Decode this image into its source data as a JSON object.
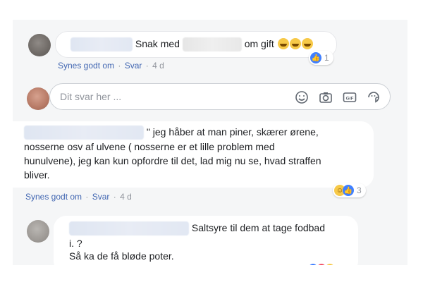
{
  "comments": [
    {
      "text_before": "Snak med",
      "text_after": "om gift",
      "reaction_count": "1",
      "actions": {
        "like": "Synes godt om",
        "reply": "Svar",
        "time": "4 d",
        "sep": "·"
      }
    },
    {
      "lines": [
        "\" jeg håber at man piner, skærer ørene,",
        "nosserne osv af ulvene ( nosserne er et lille problem med",
        "hunulvene), jeg kan kun opfordre til det, lad mig nu se, hvad straffen",
        "bliver."
      ],
      "reaction_count": "3",
      "actions": {
        "like": "Synes godt om",
        "reply": "Svar",
        "time": "4 d",
        "sep": "·"
      }
    },
    {
      "lines": [
        "Saltsyre til dem at tage fodbad",
        "i. ?",
        "Så ka de få bløde poter."
      ]
    }
  ],
  "reply": {
    "placeholder": "Dit svar her ..."
  },
  "colors": {
    "link": "#4267b2",
    "meta": "#90949c",
    "like_blue": "#4080ff",
    "haha_yellow": "#f7c948"
  },
  "icons": [
    "smiley-icon",
    "camera-icon",
    "gif-icon",
    "sticker-icon"
  ]
}
